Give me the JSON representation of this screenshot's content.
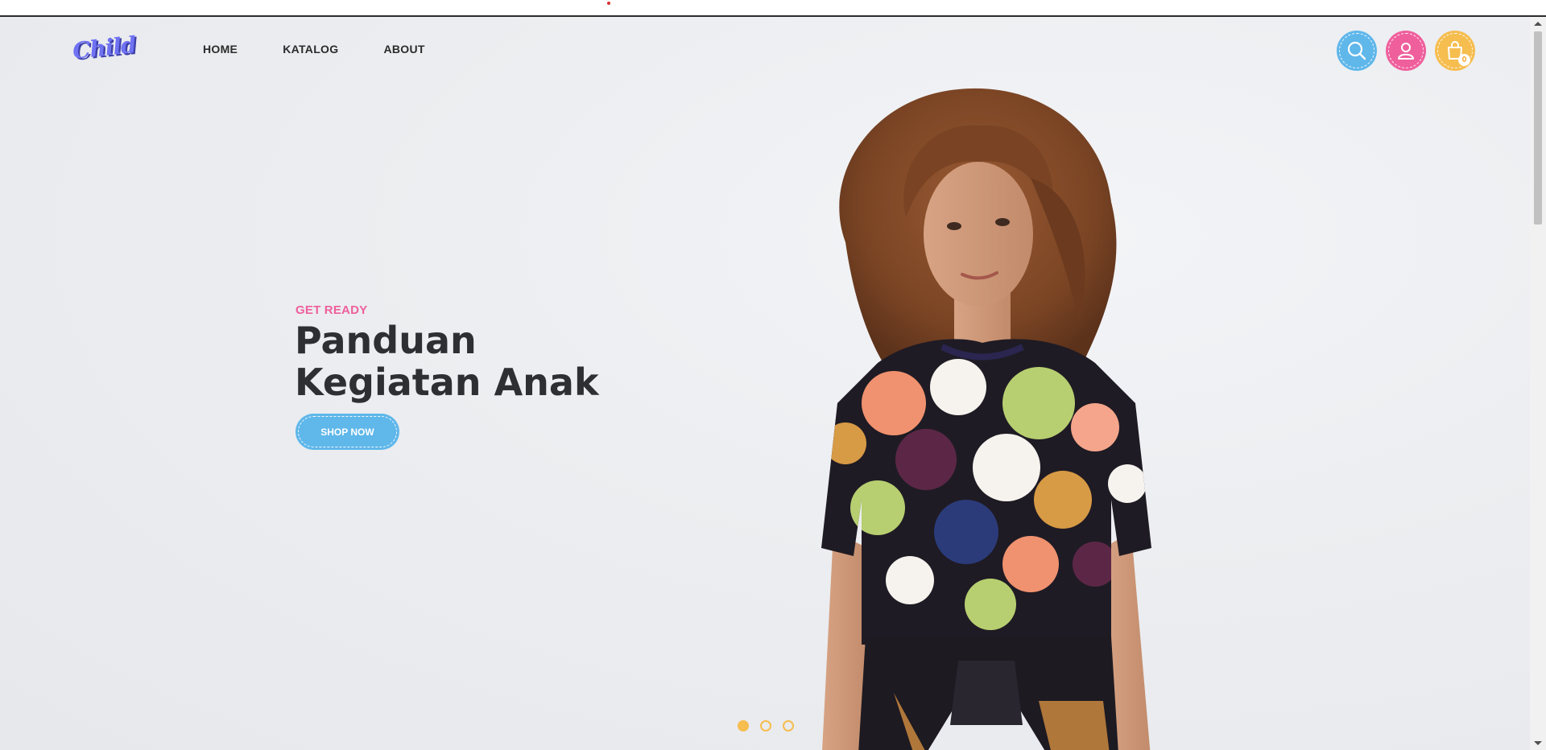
{
  "brand": {
    "logo_text": "Child"
  },
  "nav": {
    "items": [
      {
        "label": "HOME"
      },
      {
        "label": "KATALOG"
      },
      {
        "label": "ABOUT"
      }
    ]
  },
  "header_actions": {
    "search_icon": "search-icon",
    "account_icon": "user-icon",
    "cart_icon": "shopping-bag-icon",
    "cart_count": "0"
  },
  "hero": {
    "eyebrow": "GET READY",
    "title_line1": "Panduan",
    "title_line2": "Kegiatan Anak",
    "cta_label": "SHOP NOW"
  },
  "slider": {
    "slides": 3,
    "active": 1
  },
  "colors": {
    "primary_blue": "#5fb7ea",
    "primary_pink": "#ef5f9c",
    "primary_yellow": "#f6bd4f",
    "logo_purple": "#6f72f2",
    "text_dark": "#2e2f33"
  }
}
